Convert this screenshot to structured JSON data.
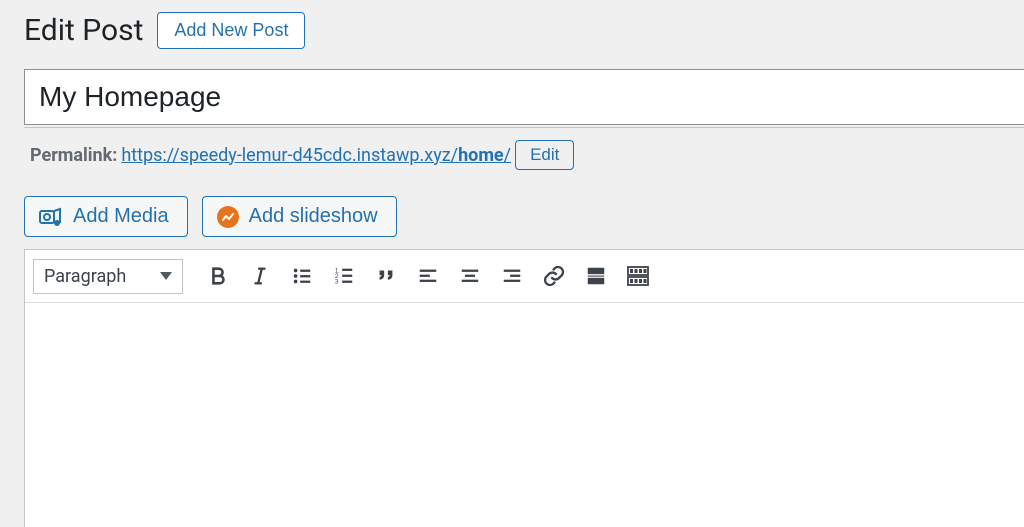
{
  "header": {
    "page_title": "Edit Post",
    "add_new_label": "Add New Post"
  },
  "post": {
    "title": "My Homepage",
    "content": ""
  },
  "permalink": {
    "label": "Permalink:",
    "base": "https://speedy-lemur-d45cdc.instawp.xyz/",
    "slug": "home",
    "trailing": "/",
    "edit_label": "Edit"
  },
  "media": {
    "add_media_label": "Add Media",
    "add_slideshow_label": "Add slideshow"
  },
  "toolbar": {
    "format_label": "Paragraph"
  }
}
